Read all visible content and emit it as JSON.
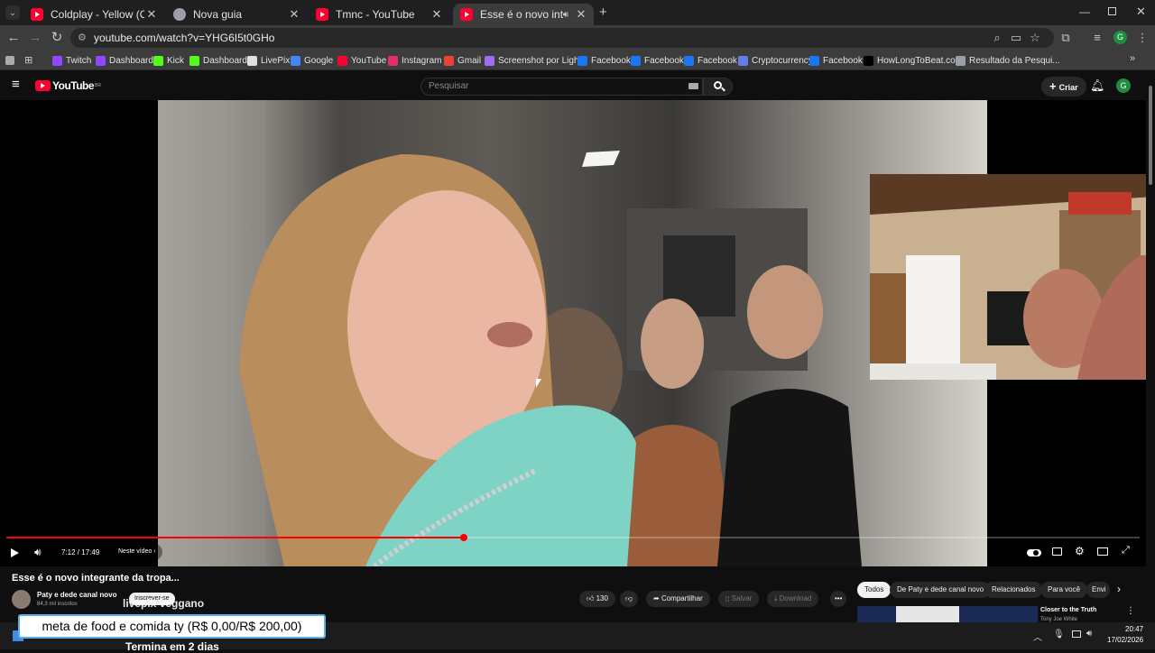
{
  "browser": {
    "tabs": [
      {
        "title": "Coldplay - Yellow (Official Video",
        "favicon": "youtube-icon"
      },
      {
        "title": "Nova guia",
        "favicon": "globe-icon"
      },
      {
        "title": "Tmnc - YouTube",
        "favicon": "youtube-icon"
      },
      {
        "title": "Esse é o novo integrante da",
        "favicon": "youtube-icon",
        "active": true
      }
    ],
    "new_tab": "+",
    "url": "youtube.com/watch?v=YHG6I5t0GHo",
    "bookmarks": [
      {
        "label": "Twitch",
        "color": "#9146ff"
      },
      {
        "label": "Dashboard",
        "color": "#9146ff"
      },
      {
        "label": "Kick",
        "color": "#53fc18"
      },
      {
        "label": "Dashboard",
        "color": "#53fc18"
      },
      {
        "label": "LivePix",
        "color": "#e0e0e0"
      },
      {
        "label": "Google",
        "color": "#4285f4"
      },
      {
        "label": "YouTube",
        "color": "#ff0033"
      },
      {
        "label": "Instagram",
        "color": "#e1306c"
      },
      {
        "label": "Gmail",
        "color": "#ea4335"
      },
      {
        "label": "Screenshot por Ligh...",
        "color": "#a26bf5"
      },
      {
        "label": "Facebook",
        "color": "#1877f2"
      },
      {
        "label": "Facebook",
        "color": "#1877f2"
      },
      {
        "label": "Facebook",
        "color": "#1877f2"
      },
      {
        "label": "Cryptocurrency",
        "color": "#627eea"
      },
      {
        "label": "Facebook",
        "color": "#1877f2"
      },
      {
        "label": "HowLongToBeat.co...",
        "color": "#000000"
      },
      {
        "label": "Resultado da Pesqui...",
        "color": "#9aa0a6"
      }
    ],
    "profile_initial": "G"
  },
  "youtube": {
    "logo_text": "YouTube",
    "logo_region": "BR",
    "search_placeholder": "Pesquisar",
    "create_label": "Criar",
    "avatar_initial": "G",
    "player": {
      "time": "7:12 / 17:49",
      "chapter": "Neste vídeo",
      "progress": 0.404
    },
    "video_title": "Esse é o novo integrante da tropa...",
    "channel_name": "Paty e dede canal novo",
    "subscribers": "84,3 mil inscritos",
    "subscribe_label": "Inscrever-se",
    "overlay_caption": "livepix veggano",
    "likes": "130",
    "share_label": "Compartilhar",
    "save_label": "Salvar",
    "download_label": "Download",
    "chips": [
      "Todos",
      "De Paty e dede canal novo",
      "Relacionados",
      "Para você",
      "Envi"
    ],
    "rec_title": "Closer to the Truth",
    "rec_channel": "Tony Joe White"
  },
  "stream_overlay": {
    "goal_text": "meta de food e comida ty (R$ 0,00/R$ 200,00)",
    "ending_text": "Termina em 2 dias"
  },
  "taskbar": {
    "time": "20:47",
    "date": "17/02/2026"
  }
}
